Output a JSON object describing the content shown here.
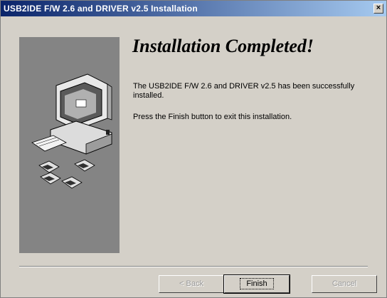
{
  "window": {
    "title": "USB2IDE F/W 2.6 and DRIVER v2.5  Installation",
    "close_label": "×"
  },
  "content": {
    "heading": "Installation Completed!",
    "message_line1": "The USB2IDE F/W 2.6 and DRIVER v2.5  has been successfully installed.",
    "message_line2": "Press the Finish button to exit this installation."
  },
  "buttons": {
    "back_label": "< Back",
    "finish_label": "Finish",
    "cancel_label": "Cancel"
  },
  "illustration": {
    "icon": "computer-with-floppy-disks-icon",
    "panel_color": "#848484"
  }
}
